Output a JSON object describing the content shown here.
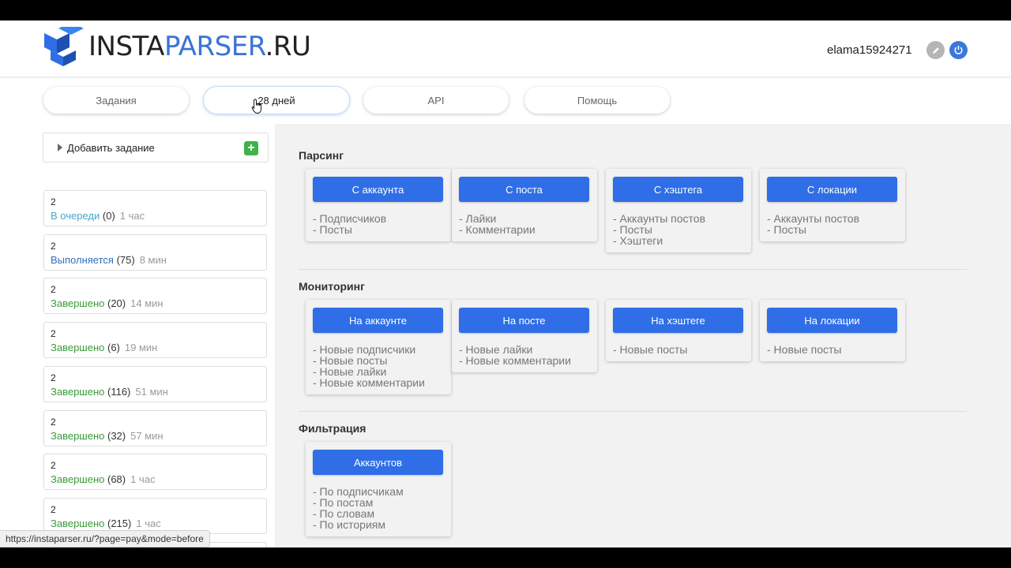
{
  "header": {
    "logo": {
      "insta": "INSTA",
      "parser": "PARSER",
      "ru": ".RU"
    },
    "username": "elama15924271",
    "edit_icon": "pencil-icon",
    "power_icon": "power-icon"
  },
  "nav": {
    "tabs": [
      {
        "label": "Задания"
      },
      {
        "label": "28 дней"
      },
      {
        "label": "API"
      },
      {
        "label": "Помощь"
      }
    ]
  },
  "sidebar": {
    "add_task_label": "Добавить задание",
    "jobs": [
      {
        "num": "2",
        "status": "В очереди",
        "count": "(0)",
        "time": "1 час"
      },
      {
        "num": "2",
        "status": "Выполняется",
        "count": "(75)",
        "time": "8 мин"
      },
      {
        "num": "2",
        "status": "Завершено",
        "count": "(20)",
        "time": "14 мин"
      },
      {
        "num": "2",
        "status": "Завершено",
        "count": "(6)",
        "time": "19 мин"
      },
      {
        "num": "2",
        "status": "Завершено",
        "count": "(116)",
        "time": "51 мин"
      },
      {
        "num": "2",
        "status": "Завершено",
        "count": "(32)",
        "time": "57 мин"
      },
      {
        "num": "2",
        "status": "Завершено",
        "count": "(68)",
        "time": "1 час"
      },
      {
        "num": "2",
        "status": "Завершено",
        "count": "(215)",
        "time": "1 час"
      }
    ]
  },
  "main": {
    "sections": [
      {
        "title": "Парсинг",
        "cards": [
          {
            "button": "С аккаунта",
            "items": [
              "- Подписчиков",
              "- Посты"
            ]
          },
          {
            "button": "С поста",
            "items": [
              "- Лайки",
              "- Комментарии"
            ]
          },
          {
            "button": "С хэштега",
            "items": [
              "- Аккаунты постов",
              "- Посты",
              "- Хэштеги"
            ]
          },
          {
            "button": "С локации",
            "items": [
              "- Аккаунты постов",
              "- Посты"
            ]
          }
        ]
      },
      {
        "title": "Мониторинг",
        "cards": [
          {
            "button": "На аккаунте",
            "items": [
              "- Новые подписчики",
              "- Новые посты",
              "- Новые лайки",
              "- Новые комментарии"
            ]
          },
          {
            "button": "На посте",
            "items": [
              "- Новые лайки",
              "- Новые комментарии"
            ]
          },
          {
            "button": "На хэштеге",
            "items": [
              "- Новые посты"
            ]
          },
          {
            "button": "На локации",
            "items": [
              "- Новые посты"
            ]
          }
        ]
      },
      {
        "title": "Фильтрация",
        "cards": [
          {
            "button": "Аккаунтов",
            "items": [
              "- По подписчикам",
              "- По постам",
              "- По словам",
              "- По историям"
            ]
          }
        ]
      }
    ]
  },
  "statusbar": {
    "url": "https://instaparser.ru/?page=pay&mode=before"
  },
  "colors": {
    "accent": "#2f6ee6",
    "done": "#3a9b3a",
    "running": "#2f6fbf",
    "queued": "#4aa6c9",
    "add": "#3fb24a"
  }
}
